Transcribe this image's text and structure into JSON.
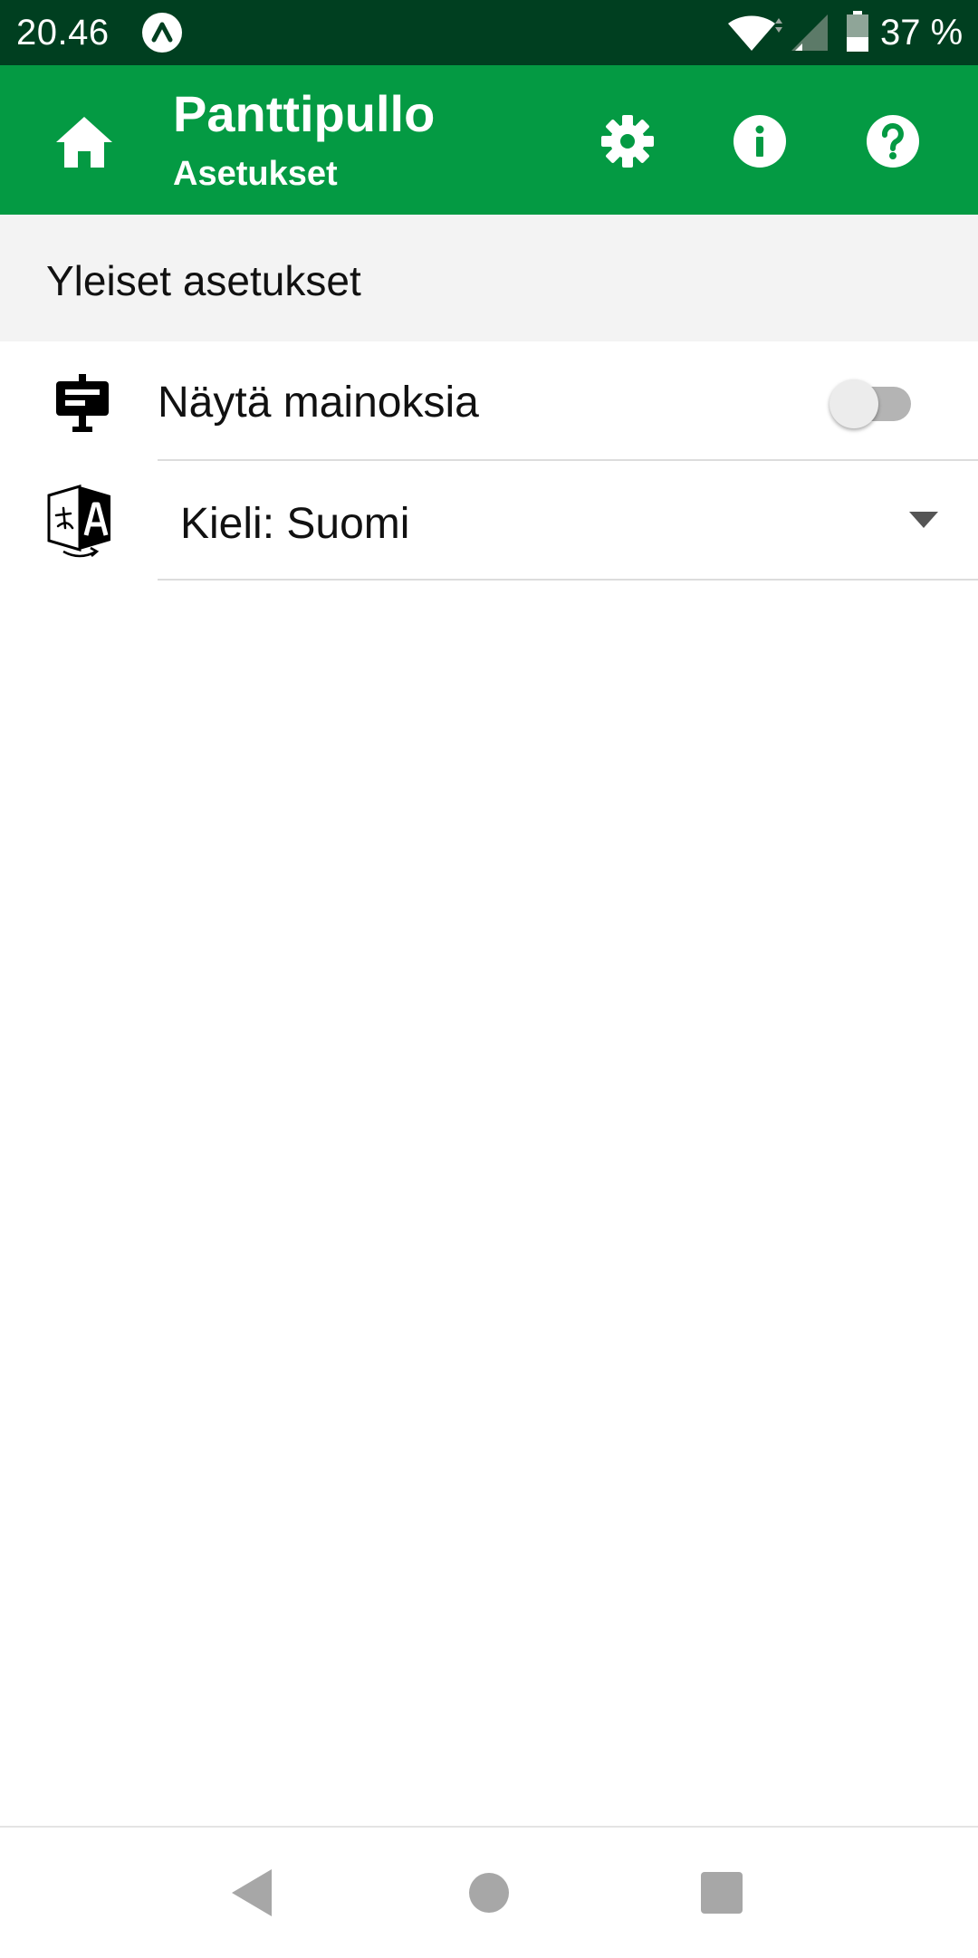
{
  "status_bar": {
    "time": "20.46",
    "battery_text": "37 %",
    "icons": [
      "app-notification-icon",
      "wifi-icon",
      "cell-signal-icon",
      "battery-icon"
    ]
  },
  "app_bar": {
    "title": "Panttipullo",
    "subtitle": "Asetukset",
    "icons": [
      "home-icon",
      "gear-icon",
      "info-icon",
      "help-icon"
    ]
  },
  "settings": {
    "section_title": "Yleiset asetukset",
    "ads": {
      "label": "Näytä mainoksia",
      "enabled": false,
      "icon": "billboard-icon"
    },
    "language": {
      "label": "Kieli: Suomi",
      "icon": "translate-icon"
    }
  },
  "nav_bar": {
    "icons": [
      "back-triangle-icon",
      "home-circle-icon",
      "recents-square-icon"
    ]
  },
  "colors": {
    "status_bar": "#003f20",
    "app_bar": "#049a43",
    "section_bg": "#f3f3f3",
    "toggle_track": "#b4b4b4",
    "toggle_thumb": "#ececec"
  }
}
